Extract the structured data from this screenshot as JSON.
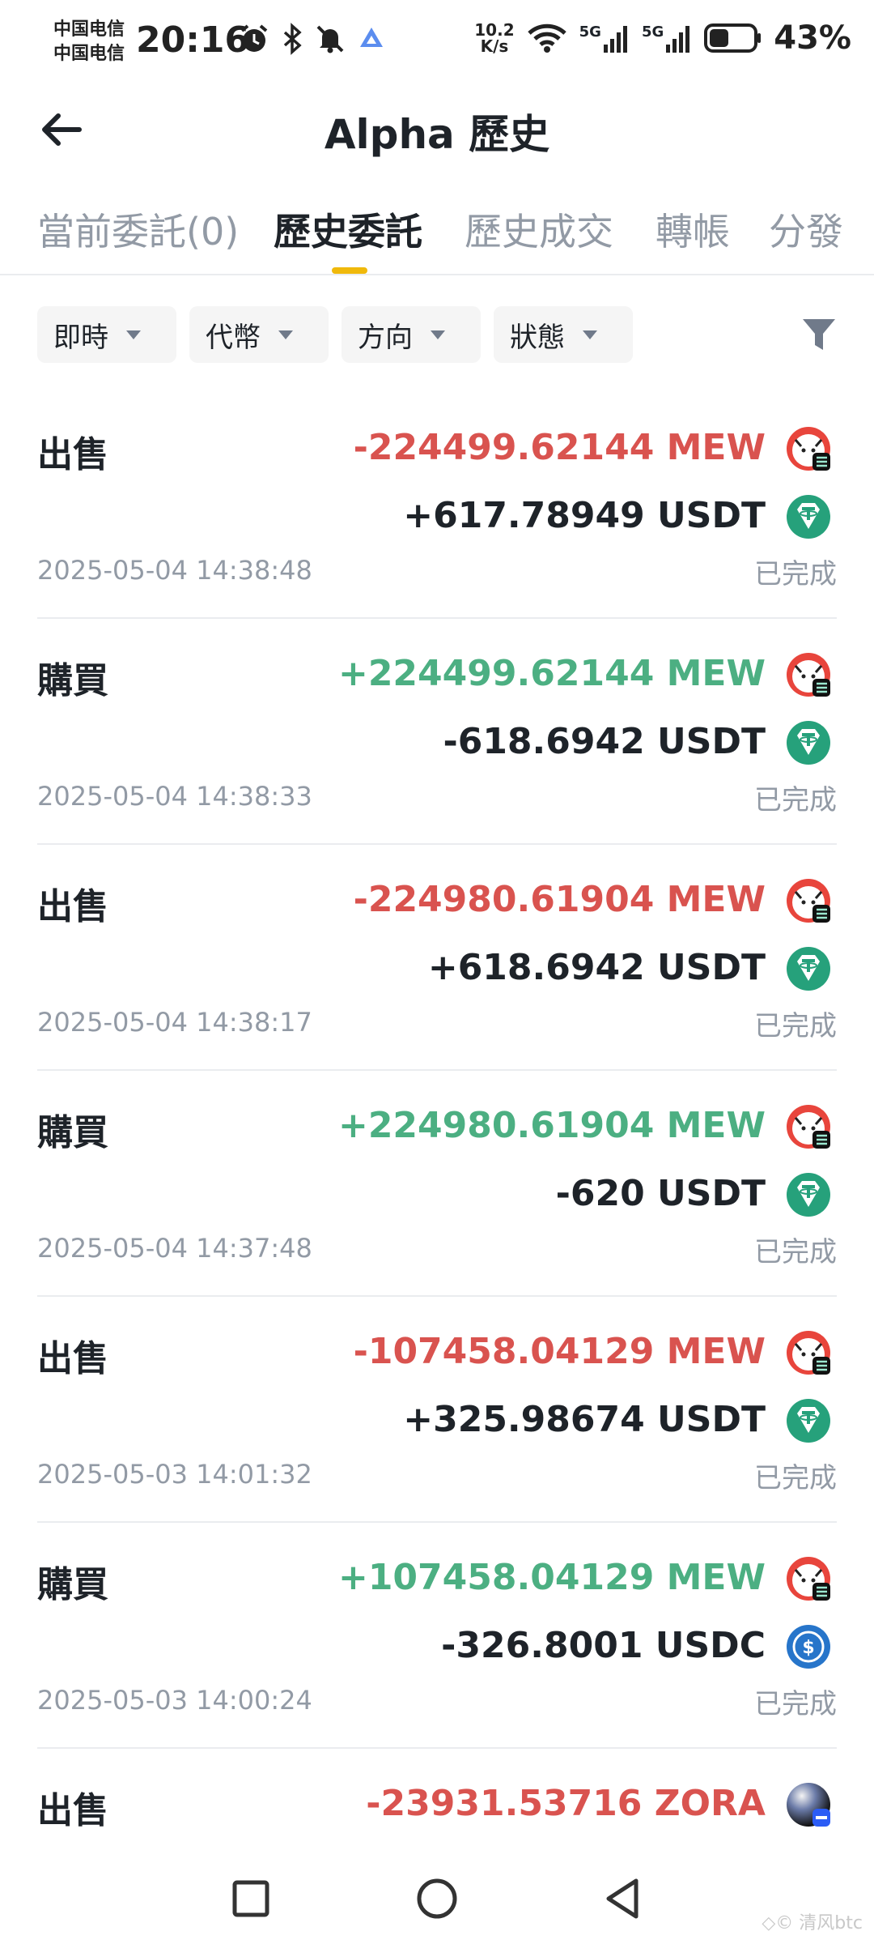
{
  "status_bar": {
    "carrier1": "中国电信",
    "carrier2": "中国电信",
    "time": "20:16",
    "net_speed_value": "10.2",
    "net_speed_unit": "K/s",
    "signal1_label": "5G",
    "signal2_label": "5G",
    "battery": "43%",
    "battery_level": 0.43
  },
  "header": {
    "title": "Alpha 歷史"
  },
  "tabs": [
    {
      "label": "當前委託(0)",
      "active": false
    },
    {
      "label": "歷史委託",
      "active": true
    },
    {
      "label": "歷史成交",
      "active": false
    },
    {
      "label": "轉帳",
      "active": false
    },
    {
      "label": "分發",
      "active": false
    }
  ],
  "filters": [
    {
      "label": "即時"
    },
    {
      "label": "代幣"
    },
    {
      "label": "方向"
    },
    {
      "label": "狀態"
    }
  ],
  "orders": [
    {
      "side": "出售",
      "amount1": "-224499.62144 MEW",
      "amount1_color": "neg",
      "amount2": "+617.78949 USDT",
      "coin1": "mew",
      "coin2": "usdt",
      "time": "2025-05-04 14:38:48",
      "status": "已完成"
    },
    {
      "side": "購買",
      "amount1": "+224499.62144 MEW",
      "amount1_color": "pos",
      "amount2": "-618.6942 USDT",
      "coin1": "mew",
      "coin2": "usdt",
      "time": "2025-05-04 14:38:33",
      "status": "已完成"
    },
    {
      "side": "出售",
      "amount1": "-224980.61904 MEW",
      "amount1_color": "neg",
      "amount2": "+618.6942 USDT",
      "coin1": "mew",
      "coin2": "usdt",
      "time": "2025-05-04 14:38:17",
      "status": "已完成"
    },
    {
      "side": "購買",
      "amount1": "+224980.61904 MEW",
      "amount1_color": "pos",
      "amount2": "-620 USDT",
      "coin1": "mew",
      "coin2": "usdt",
      "time": "2025-05-04 14:37:48",
      "status": "已完成"
    },
    {
      "side": "出售",
      "amount1": "-107458.04129 MEW",
      "amount1_color": "neg",
      "amount2": "+325.98674 USDT",
      "coin1": "mew",
      "coin2": "usdt",
      "time": "2025-05-03 14:01:32",
      "status": "已完成"
    },
    {
      "side": "購買",
      "amount1": "+107458.04129 MEW",
      "amount1_color": "pos",
      "amount2": "-326.8001 USDC",
      "coin1": "mew",
      "coin2": "usdc",
      "time": "2025-05-03 14:00:24",
      "status": "已完成"
    },
    {
      "side": "出售",
      "amount1": "-23931.53716 ZORA",
      "amount1_color": "neg",
      "amount2": "",
      "coin1": "zora",
      "coin2": "",
      "time": "",
      "status": ""
    }
  ],
  "watermark": "◇© 清风btc",
  "colors": {
    "accent": "#f0b90b",
    "sell": "#d9534f",
    "buy": "#4caf82",
    "muted": "#929aa5",
    "usdt": "#26a17b",
    "usdc": "#2775ca"
  }
}
